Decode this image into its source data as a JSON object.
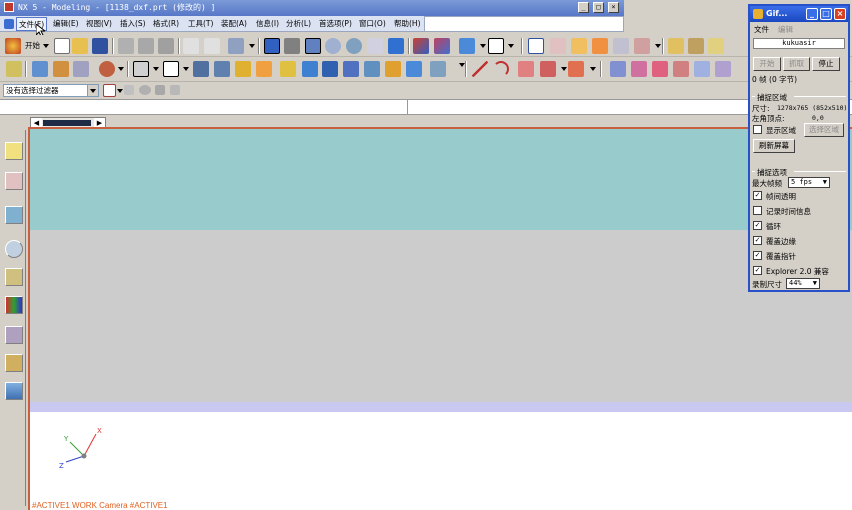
{
  "window": {
    "title": "NX 5 - Modeling - [1138_dxf.prt (修改的) ]",
    "buttons": [
      "_",
      "□",
      "×"
    ]
  },
  "menu": {
    "items": [
      "文件(F)",
      "编辑(E)",
      "视图(V)",
      "插入(S)",
      "格式(R)",
      "工具(T)",
      "装配(A)",
      "信息(I)",
      "分析(L)",
      "首选项(P)",
      "窗口(O)",
      "帮助(H)"
    ]
  },
  "toolbar": {
    "start_label": "开始"
  },
  "filter": {
    "selected": "没有选择过滤器"
  },
  "viewport": {
    "work_label": "#ACTIVE1 WORK Camera #ACTIVE1",
    "axes": {
      "x": "X",
      "y": "Y",
      "z": "Z"
    }
  },
  "gif_recorder": {
    "title": "Gif...",
    "menu": [
      "文件",
      "编辑"
    ],
    "user": "kukuasir",
    "buttons": {
      "start": "开始",
      "capture": "抓取",
      "stop": "停止"
    },
    "frames_info": "0 帧 (0 字节)",
    "capture_region": {
      "heading": "捕捉区域",
      "size_label": "尺寸:",
      "size_value": "1278x765 (852x510)",
      "corner_label": "左角顶点:",
      "corner_value": "0,0",
      "show_region_label": "显示区域",
      "show_region_checked": false,
      "select_region_button": "选择区域",
      "refresh_button": "刷新屏幕"
    },
    "capture_options": {
      "heading": "捕捉选项",
      "max_fps_label": "最大帧频",
      "max_fps_value": "5 fps",
      "options": [
        {
          "label": "帧间透明",
          "checked": true
        },
        {
          "label": "记录时间信息",
          "checked": false
        },
        {
          "label": "循环",
          "checked": true
        },
        {
          "label": "覆盖边缘",
          "checked": true
        },
        {
          "label": "覆盖指针",
          "checked": true
        },
        {
          "label": "Explorer 2.0 兼容",
          "checked": true
        }
      ],
      "record_size_label": "录制尺寸",
      "record_size_value": "44%"
    }
  }
}
